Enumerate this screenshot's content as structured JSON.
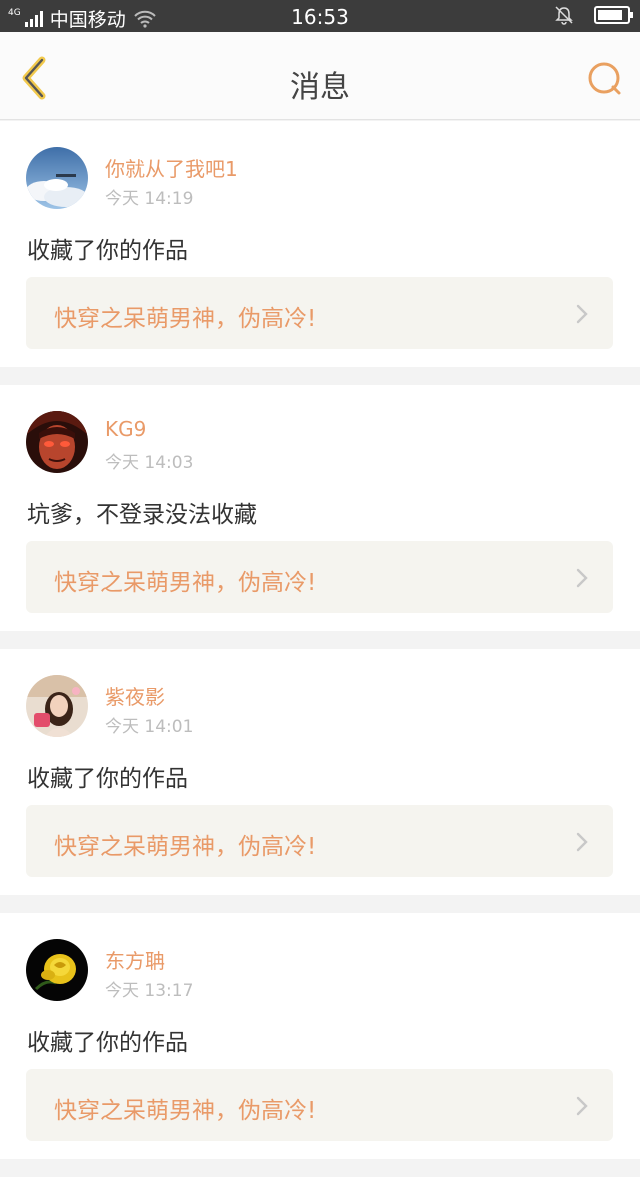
{
  "status_bar": {
    "network_type": "4G",
    "carrier": "中国移动",
    "time": "16:53",
    "icons": [
      "signal-icon",
      "wifi-icon",
      "mute-bell-icon",
      "battery-icon"
    ]
  },
  "nav": {
    "title": "消息",
    "back_icon": "chevron-left-icon",
    "search_icon": "search-icon",
    "accent_color": "#e9a060"
  },
  "messages": [
    {
      "user": "你就从了我吧1",
      "time": "今天 14:19",
      "text": "收藏了你的作品",
      "work": "快穿之呆萌男神，伪高冷!"
    },
    {
      "user": "KG9",
      "time": "今天 14:03",
      "text": "坑爹，不登录没法收藏",
      "work": "快穿之呆萌男神，伪高冷!"
    },
    {
      "user": "紫夜影",
      "time": "今天 14:01",
      "text": "收藏了你的作品",
      "work": "快穿之呆萌男神，伪高冷!"
    },
    {
      "user": "东方聃",
      "time": "今天 13:17",
      "text": "收藏了你的作品",
      "work": "快穿之呆萌男神，伪高冷!"
    }
  ],
  "colors": {
    "username": "#e99a68",
    "work_title": "#e99a68",
    "timestamp": "#bdbdbd",
    "work_box_bg": "#f5f4ef"
  }
}
